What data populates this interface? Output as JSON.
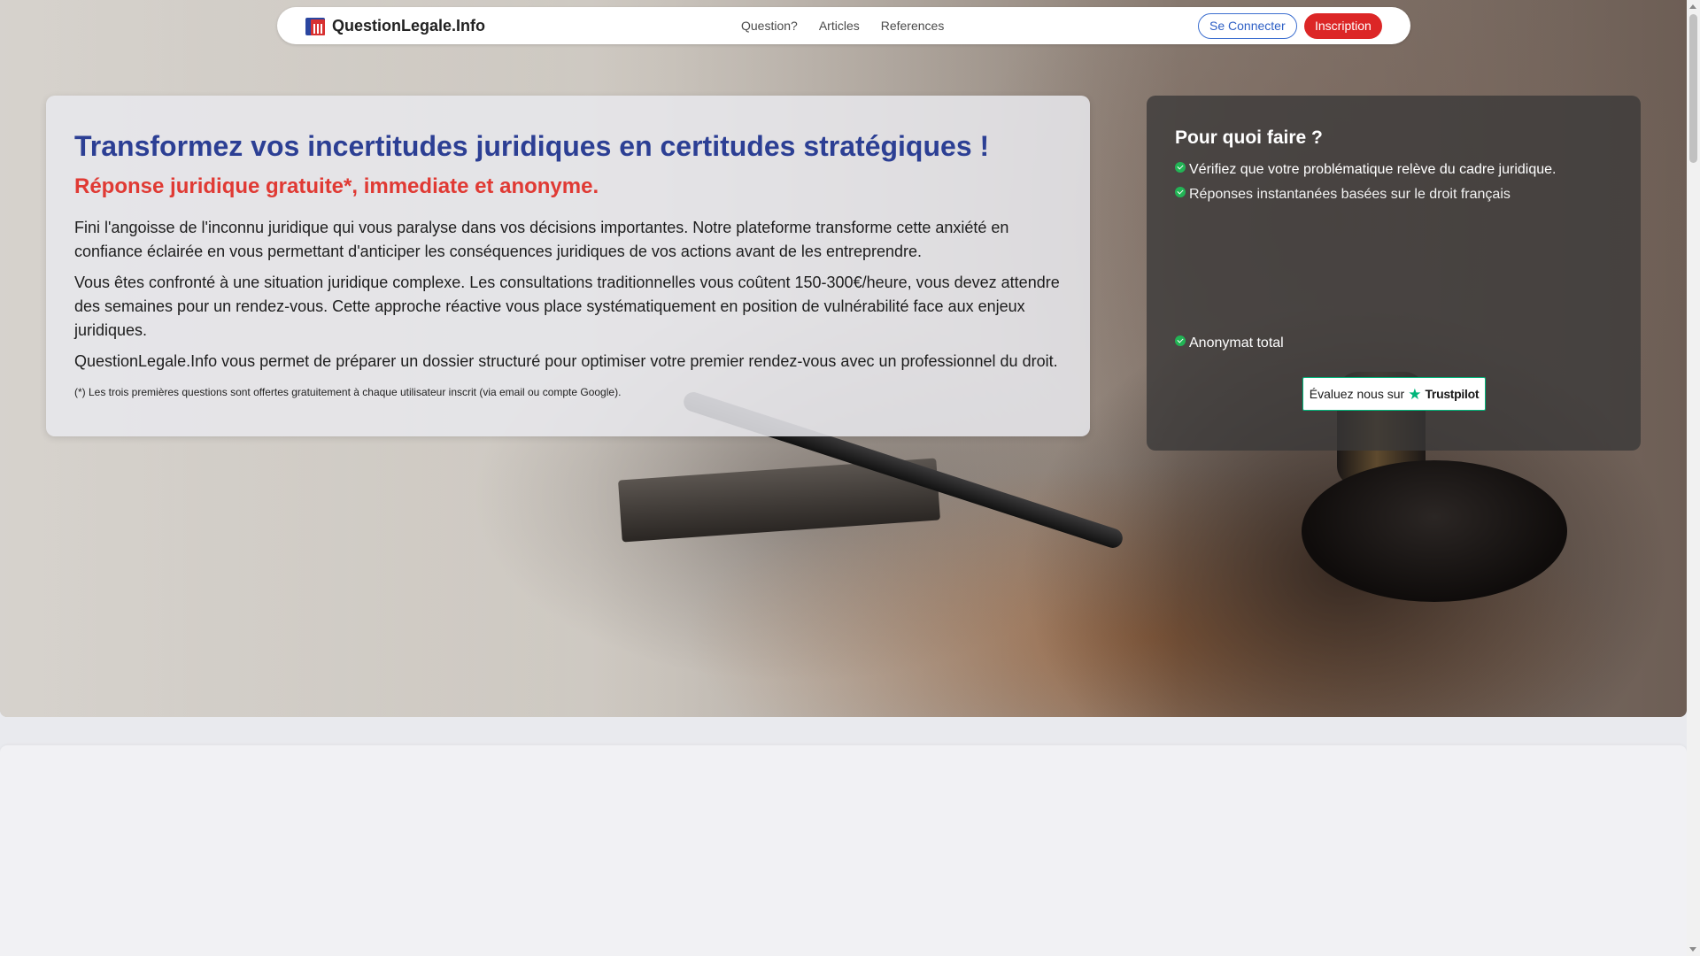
{
  "navbar": {
    "brand_name": "QuestionLegale.Info",
    "links": [
      "Question?",
      "Articles",
      "References"
    ],
    "login_label": "Se Connecter",
    "signup_label": "Inscription",
    "colors": {
      "brand_blue": "#2a46a0",
      "brand_red": "#d83131",
      "signup_bg": "#dc2626",
      "login_border": "#3d6fd0"
    }
  },
  "hero": {
    "title": "Transformez vos incertitudes juridiques en certitudes stratégiques !",
    "subtitle": "Réponse juridique gratuite*, immediate et anonyme.",
    "paragraphs": [
      "Fini l'angoisse de l'inconnu juridique qui vous paralyse dans vos décisions importantes. Notre plateforme transforme cette anxiété en confiance éclairée en vous permettant d'anticiper les conséquences juridiques de vos actions avant de les entreprendre.",
      "Vous êtes confronté à une situation juridique complexe. Les consultations traditionnelles vous coûtent 150-300€/heure, vous devez attendre des semaines pour un rendez-vous. Cette approche réactive vous place systématiquement en position de vulnérabilité face aux enjeux juridiques.",
      "QuestionLegale.Info vous permet de préparer un dossier structuré pour optimiser votre premier rendez-vous avec un professionnel du droit."
    ],
    "footnote": "(*)  Les trois premières questions sont offertes gratuitement à chaque utilisateur inscrit (via email ou compte Google).",
    "colors": {
      "title": "#2c3f94",
      "subtitle": "#e03a34"
    }
  },
  "why": {
    "title": "Pour quoi faire ?",
    "items": [
      "Vérifiez que votre problématique relève du cadre juridique.",
      "Réponses instantanées basées sur le droit français",
      "Anonymat total"
    ],
    "check_icon": "check-circle-icon",
    "check_color": "#22b455"
  },
  "trustpilot": {
    "prefix": "Évaluez nous sur",
    "brand": "Trustpilot",
    "star": "★",
    "color": "#00b67a"
  }
}
